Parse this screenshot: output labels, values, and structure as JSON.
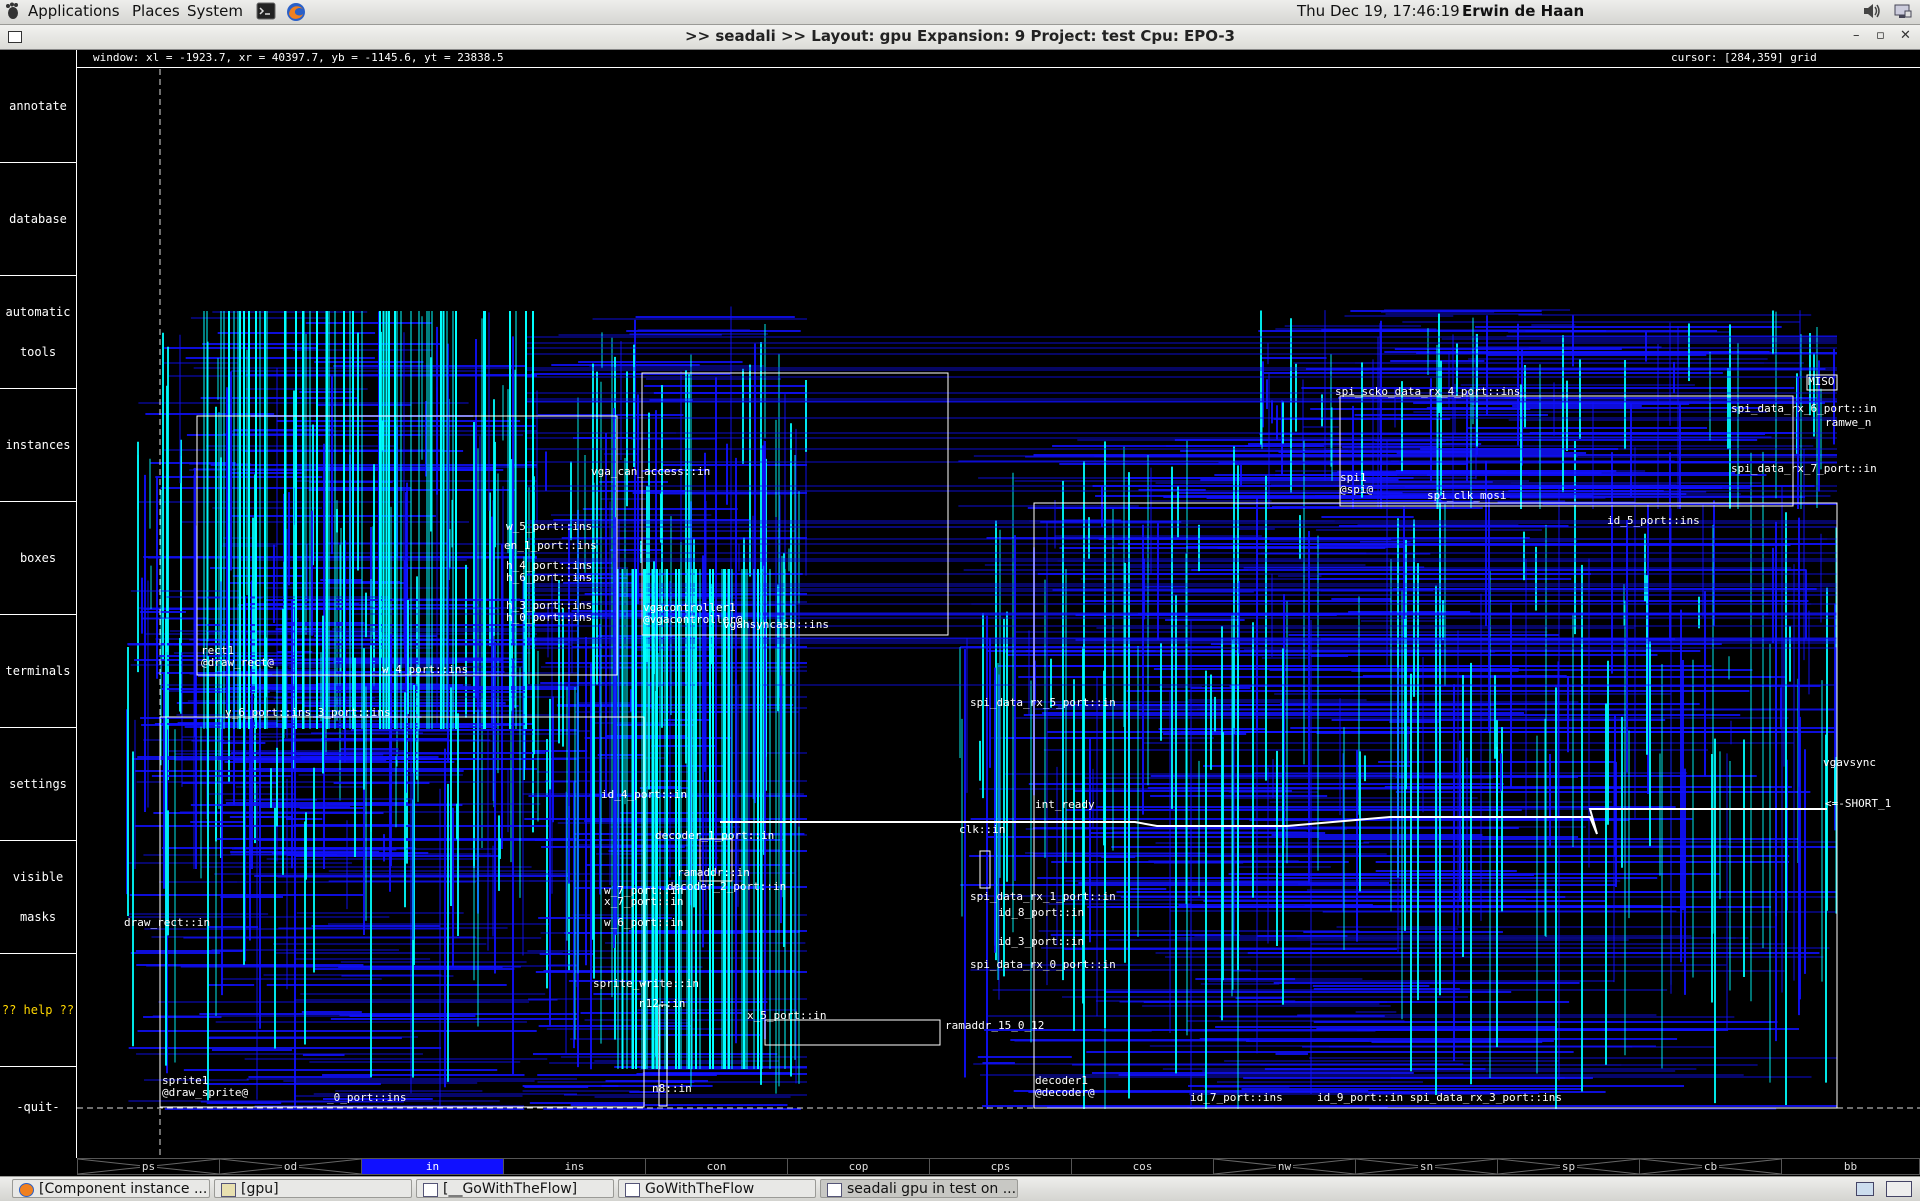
{
  "top_panel": {
    "menus": [
      "Applications",
      "Places",
      "System"
    ],
    "clock": "Thu Dec 19, 17:46:19",
    "user": "Erwin de Haan",
    "icons": [
      "gnome-foot-icon",
      "terminal-icon",
      "firefox-icon",
      "volume-icon",
      "network-icon"
    ]
  },
  "window": {
    "title": ">> seadali >>    Layout: gpu   Expansion: 9   Project: test   Cpu: EPO-3",
    "controls": [
      "–",
      "▫",
      "✕"
    ]
  },
  "info": {
    "window_coords": "window: xl = -1923.7, xr = 40397.7, yb = -1145.6, yt = 23838.5",
    "cursor": "cursor: [284,359] grid"
  },
  "menu": {
    "items": [
      {
        "line1": "annotate",
        "line2": ""
      },
      {
        "line1": "database",
        "line2": ""
      },
      {
        "line1": "automatic",
        "line2": "tools"
      },
      {
        "line1": "instances",
        "line2": ""
      },
      {
        "line1": "boxes",
        "line2": ""
      },
      {
        "line1": "terminals",
        "line2": ""
      },
      {
        "line1": "settings",
        "line2": ""
      },
      {
        "line1": "visible",
        "line2": "masks"
      },
      {
        "line1": "?? help ??",
        "line2": ""
      },
      {
        "line1": "-quit-",
        "line2": ""
      }
    ]
  },
  "labels": {
    "l01": "vga_can_access::in",
    "l02": "w_5_port::ins",
    "l03": "en_1_port::ins",
    "l04": "h_4_port::ins",
    "l05": "h_6_port::ins",
    "l06": "h_3_port::ins",
    "l07": "h_0_port::ins",
    "l08": "rect1",
    "l09": "@draw_rect@",
    "l10": "w_4_port::ins",
    "l11": "y_6_port::ins 3_port::ins",
    "l12": "vgacontroller1",
    "l13": "@vgacontroller@",
    "l14": "vgahsyncasb::ins",
    "l15": "spi_data_rx_5_port::in",
    "l16": "id_4_port::in",
    "l17": "int_ready",
    "l18": "clk::in",
    "l19": "decoder_1_port::in",
    "l20": "w_7_port::in",
    "l21": "x_7_port::in",
    "l22": "w_6_port::in",
    "l23": "draw_rect::in",
    "l24": "spi_data_rx_1_port::in",
    "l25": "id_8_port::in",
    "l26": "id_3_port::in",
    "l27": "spi_data_rx_0_port::in",
    "l28": "sprite_write::in",
    "l29": "n12::in",
    "l30": "ramaddr_15_0_12",
    "l31": "sprite1",
    "l32": "@draw_sprite@",
    "l33": "_0_port::ins",
    "l34": "n8::in",
    "l35": "decoder1",
    "l36": "@decoder@",
    "l37": "id_7_port::ins",
    "l38": "id_9_port::in  spi_data_rx_3_port::ins",
    "l39": "spi1",
    "l40": "@spi@",
    "l41": "spi_clk_mosi",
    "l42": "spi_data_rx_6_port::in",
    "l43": "ramwe_n",
    "l44": "spi_data_rx_7_port::in",
    "l45": "id_5_port::ins",
    "l46": "vgavsync",
    "l47": "<=-SHORT_1",
    "l48": "spi_scko_data_rx_4_port::ins",
    "l49": "MISO",
    "l50": "ramaddr::in",
    "l51": "decoder_2_port::in",
    "l52": "x_5_port::in"
  },
  "layers": {
    "items": [
      "ps",
      "od",
      "in",
      "ins",
      "con",
      "cop",
      "cps",
      "cos",
      "nw",
      "sn",
      "sp",
      "cb",
      "bb"
    ],
    "active": "in"
  },
  "taskbar": {
    "tasks": [
      "[Component instance ...",
      "[gpu]",
      "[__GoWithTheFlow]",
      "GoWithTheFlow",
      "seadali  gpu in test on ..."
    ]
  },
  "colors": {
    "background": "#000000",
    "wire_blue": "#1010ff",
    "wire_cyan": "#00ffff",
    "box_outline": "#ffffff",
    "active_layer": "#1010ff",
    "help_text": "#ffd700"
  }
}
